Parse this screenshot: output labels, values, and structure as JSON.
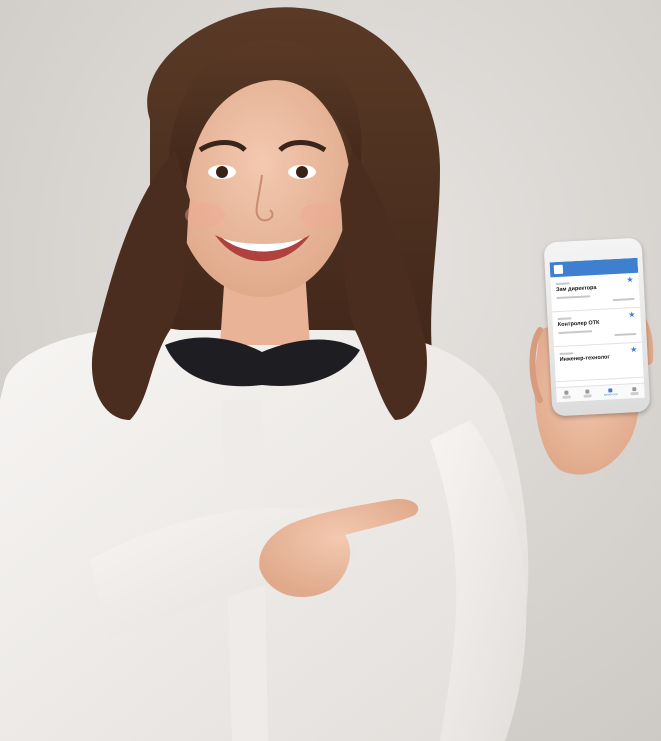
{
  "phone_app": {
    "name": "",
    "logo_text": "",
    "accent_color": "#3f7fd0",
    "jobs": [
      {
        "title": "Зам директора"
      },
      {
        "title": "Контролер ОТК"
      },
      {
        "title": "Инженер-технолог"
      }
    ],
    "nav": [
      {
        "icon": "home-icon"
      },
      {
        "icon": "list-icon"
      },
      {
        "icon": "star-icon",
        "label": "ВАКАНСИИ",
        "active": true
      },
      {
        "icon": "user-icon"
      }
    ]
  }
}
